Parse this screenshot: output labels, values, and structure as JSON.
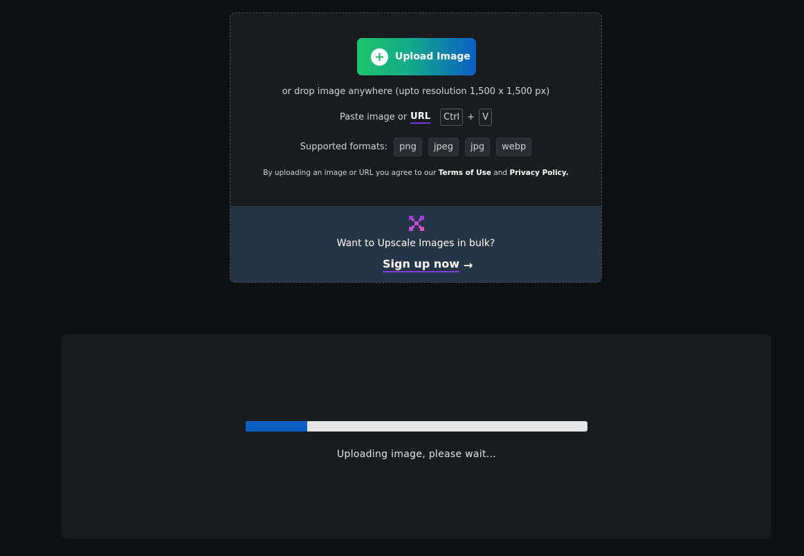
{
  "upload": {
    "button_label": "Upload Image",
    "drop_hint": "or drop image anywhere (upto resolution 1,500 x 1,500 px)",
    "paste_prefix": "Paste image or",
    "url_link": "URL",
    "key_ctrl": "Ctrl",
    "key_plus": "+",
    "key_v": "V",
    "formats_label": "Supported formats:",
    "formats": [
      "png",
      "jpeg",
      "jpg",
      "webp"
    ],
    "terms_prefix": "By uploading an image or URL you agree to our",
    "terms_link": "Terms of Use",
    "terms_and": "and",
    "privacy_link": "Privacy Policy."
  },
  "bulk": {
    "icon": "grid-icon",
    "text": "Want to Upscale Images in bulk?",
    "signup_label": "Sign up now",
    "arrow": "→"
  },
  "progress": {
    "value_percent": 18,
    "status_text": "Uploading image, please wait..."
  },
  "colors": {
    "background": "#0f1013",
    "card": "#1a1b1e",
    "bulk_bg": "#263545",
    "accent_blue": "#0a5ec0",
    "accent_green": "#1fc46b",
    "underline_purple": "#8a3df0"
  }
}
